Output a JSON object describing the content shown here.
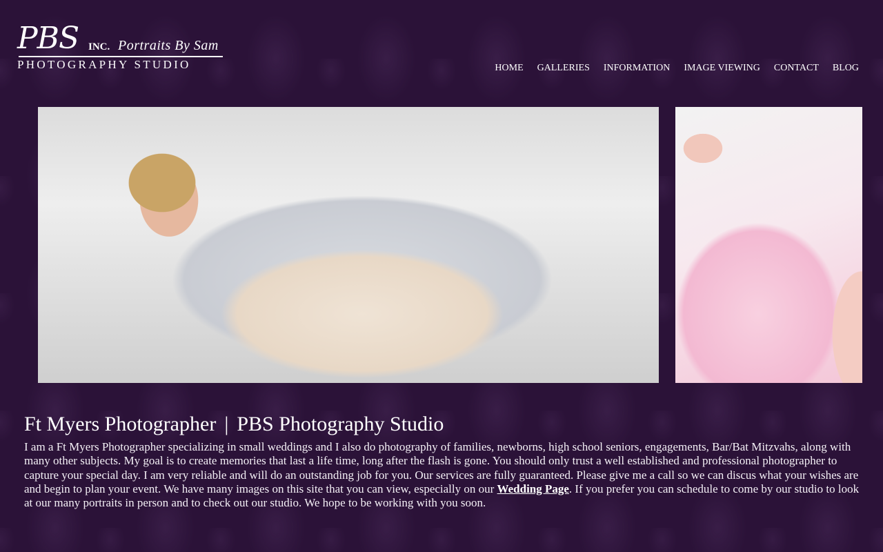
{
  "logo": {
    "initials": "PBS",
    "inc": "INC.",
    "tagline": "Portraits By Sam",
    "subtitle": "PHOTOGRAPHY STUDIO"
  },
  "nav": {
    "items": [
      {
        "label": "HOME"
      },
      {
        "label": "GALLERIES"
      },
      {
        "label": "INFORMATION"
      },
      {
        "label": "IMAGE VIEWING"
      },
      {
        "label": "CONTACT"
      },
      {
        "label": "BLOG"
      }
    ]
  },
  "main": {
    "title_left": "Ft Myers Photographer",
    "title_separator": "|",
    "title_right": "PBS Photography Studio",
    "intro_before_link": "I am a Ft Myers Photographer specializing in small weddings and I also do photography of families, newborns, high school seniors, engagements, Bar/Bat Mitzvahs, along with many other subjects. My goal is to create memories that last a life time, long after the flash is gone. You should only trust a well established and professional photographer to capture your special day. I am very reliable and will do an outstanding job for you. Our services are fully guaranteed. Please give me a call so we can discus what your wishes are and begin to plan your event. We have many images on this site that you can view, especially on our ",
    "link_text": "Wedding Page",
    "intro_after_link": ". If you prefer you can schedule to come by our studio to look at our many portraits in person and to check out our studio. We hope to be working with you soon."
  },
  "colors": {
    "background": "#2b1238",
    "text": "#ffffff"
  }
}
